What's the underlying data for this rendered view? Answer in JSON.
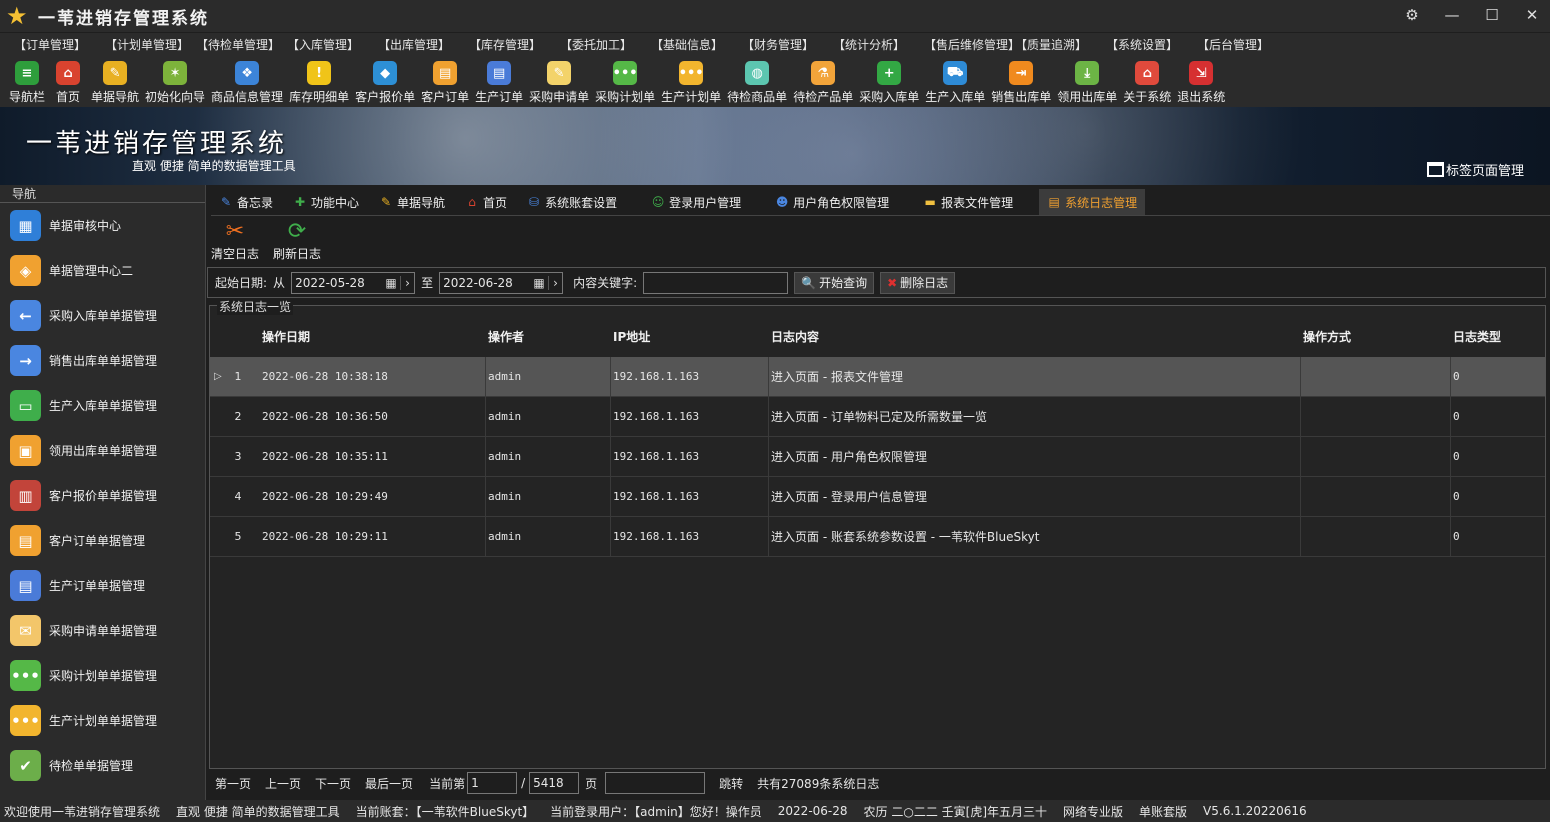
{
  "app": {
    "title": "一苇进销存管理系统"
  },
  "menu": [
    "【订单管理】",
    "【计划单管理】",
    "【待检单管理】",
    "【入库管理】",
    "【出库管理】",
    "【库存管理】",
    "【委托加工】",
    "【基础信息】",
    "【财务管理】",
    "【统计分析】",
    "【售后维修管理】",
    "【质量追溯】",
    "【系统设置】",
    "【后台管理】"
  ],
  "toolbar": [
    {
      "label": "导航栏",
      "icon": "menu-icon",
      "color": "#2e9e3c"
    },
    {
      "label": "首页",
      "icon": "home-icon",
      "color": "#d9432f"
    },
    {
      "label": "单据导航",
      "icon": "pen-icon",
      "color": "#e8b022"
    },
    {
      "label": "初始化向导",
      "icon": "wand-icon",
      "color": "#7db33b"
    },
    {
      "label": "商品信息管理",
      "icon": "cubes-icon",
      "color": "#3c84d8"
    },
    {
      "label": "库存明细单",
      "icon": "warning-icon",
      "color": "#f0c419"
    },
    {
      "label": "客户报价单",
      "icon": "tag-icon",
      "color": "#2d8fd5"
    },
    {
      "label": "客户订单",
      "icon": "doc-icon",
      "color": "#f0a130"
    },
    {
      "label": "生产订单",
      "icon": "doc-icon",
      "color": "#4a7bd8"
    },
    {
      "label": "采购申请单",
      "icon": "pencil-paper-icon",
      "color": "#f3d36a"
    },
    {
      "label": "采购计划单",
      "icon": "dots-icon",
      "color": "#55b847"
    },
    {
      "label": "生产计划单",
      "icon": "dots-icon",
      "color": "#f2b52e"
    },
    {
      "label": "待检商品单",
      "icon": "bottle-icon",
      "color": "#5cc6b0"
    },
    {
      "label": "待检产品单",
      "icon": "flask-icon",
      "color": "#f2a43a"
    },
    {
      "label": "采购入库单",
      "icon": "plus-icon",
      "color": "#33a844"
    },
    {
      "label": "生产入库单",
      "icon": "cart-icon",
      "color": "#2e8bd6"
    },
    {
      "label": "销售出库单",
      "icon": "box-out-icon",
      "color": "#f08a1e"
    },
    {
      "label": "领用出库单",
      "icon": "download-icon",
      "color": "#6cb445"
    },
    {
      "label": "关于系统",
      "icon": "house-icon",
      "color": "#e04a3c"
    },
    {
      "label": "退出系统",
      "icon": "exit-icon",
      "color": "#d63031"
    }
  ],
  "banner": {
    "title": "一苇进销存管理系统",
    "subtitle": "直观 便捷 简单的数据管理工具",
    "tag_manager": "标签页面管理"
  },
  "leftnav": {
    "header": "导航",
    "items": [
      {
        "label": "单据审核中心",
        "color": "#2f7fd8",
        "icon": "grid-icon"
      },
      {
        "label": "单据管理中心二",
        "color": "#f0a130",
        "icon": "grid-diamond-icon"
      },
      {
        "label": "采购入库单单据管理",
        "color": "#4a86e0",
        "icon": "arrow-in-icon"
      },
      {
        "label": "销售出库单单据管理",
        "color": "#4a86e0",
        "icon": "arrow-out-icon"
      },
      {
        "label": "生产入库单单据管理",
        "color": "#3fae4b",
        "icon": "folder-in-icon"
      },
      {
        "label": "领用出库单单据管理",
        "color": "#f0a130",
        "icon": "folder-out-icon"
      },
      {
        "label": "客户报价单单据管理",
        "color": "#c2443a",
        "icon": "books-icon"
      },
      {
        "label": "客户订单单据管理",
        "color": "#f0a130",
        "icon": "doc-icon"
      },
      {
        "label": "生产订单单据管理",
        "color": "#4a7bd8",
        "icon": "doc-icon"
      },
      {
        "label": "采购申请单单据管理",
        "color": "#f3c66a",
        "icon": "mail-icon"
      },
      {
        "label": "采购计划单单据管理",
        "color": "#55b847",
        "icon": "dots-icon"
      },
      {
        "label": "生产计划单单据管理",
        "color": "#f2b52e",
        "icon": "dots-icon"
      },
      {
        "label": "待检单单据管理",
        "color": "#6cae4a",
        "icon": "check-doc-icon"
      }
    ]
  },
  "tabs": [
    {
      "label": "备忘录",
      "icon": "memo-icon",
      "color": "#4a86e0"
    },
    {
      "label": "功能中心",
      "icon": "puzzle-icon",
      "color": "#3fae4b"
    },
    {
      "label": "单据导航",
      "icon": "pen-icon",
      "color": "#e8b022"
    },
    {
      "label": "首页",
      "icon": "home-icon",
      "color": "#d9432f"
    },
    {
      "label": "系统账套设置",
      "icon": "db-icon",
      "color": "#4a86e0"
    },
    {
      "label": "登录用户管理",
      "icon": "user-icon",
      "color": "#3fae4b"
    },
    {
      "label": "用户角色权限管理",
      "icon": "users-icon",
      "color": "#4a86e0"
    },
    {
      "label": "报表文件管理",
      "icon": "folder-icon",
      "color": "#f0c040"
    },
    {
      "label": "系统日志管理",
      "icon": "log-icon",
      "color": "#f0a030"
    }
  ],
  "actions": {
    "clear": "清空日志",
    "refresh": "刷新日志"
  },
  "filter": {
    "date_label": "起始日期:",
    "from": "从",
    "from_date": "2022-05-28",
    "to": "至",
    "to_date": "2022-06-28",
    "keyword_label": "内容关键字:",
    "keyword_value": "",
    "search": "开始查询",
    "delete": "删除日志"
  },
  "grid": {
    "group_title": "系统日志一览",
    "columns": [
      "操作日期",
      "操作者",
      "IP地址",
      "日志内容",
      "操作方式",
      "日志类型"
    ],
    "rows": [
      {
        "n": "1",
        "date": "2022-06-28 10:38:18",
        "user": "admin",
        "ip": "192.168.1.163",
        "content": "进入页面 - 报表文件管理",
        "method": "",
        "type": "0"
      },
      {
        "n": "2",
        "date": "2022-06-28 10:36:50",
        "user": "admin",
        "ip": "192.168.1.163",
        "content": "进入页面 - 订单物料已定及所需数量一览",
        "method": "",
        "type": "0"
      },
      {
        "n": "3",
        "date": "2022-06-28 10:35:11",
        "user": "admin",
        "ip": "192.168.1.163",
        "content": "进入页面 - 用户角色权限管理",
        "method": "",
        "type": "0"
      },
      {
        "n": "4",
        "date": "2022-06-28 10:29:49",
        "user": "admin",
        "ip": "192.168.1.163",
        "content": "进入页面 - 登录用户信息管理",
        "method": "",
        "type": "0"
      },
      {
        "n": "5",
        "date": "2022-06-28 10:29:11",
        "user": "admin",
        "ip": "192.168.1.163",
        "content": "进入页面 - 账套系统参数设置 - 一苇软件BlueSkyt",
        "method": "",
        "type": "0"
      }
    ]
  },
  "pager": {
    "first": "第一页",
    "prev": "上一页",
    "next": "下一页",
    "last": "最后一页",
    "current_label": "当前第",
    "current": "1",
    "slash": "/",
    "total_pages": "5418",
    "page_unit": "页",
    "jump_value": "",
    "jump": "跳转",
    "total_text": "共有27089条系统日志"
  },
  "status": [
    "欢迎使用一苇进销存管理系统",
    "直观 便捷 简单的数据管理工具",
    "当前账套：【一苇软件BlueSkyt】",
    "当前登录用户：【admin】您好！操作员",
    "2022-06-28",
    "农历 二○二二 壬寅[虎]年五月三十",
    "网络专业版",
    "单账套版",
    "V5.6.1.20220616"
  ]
}
